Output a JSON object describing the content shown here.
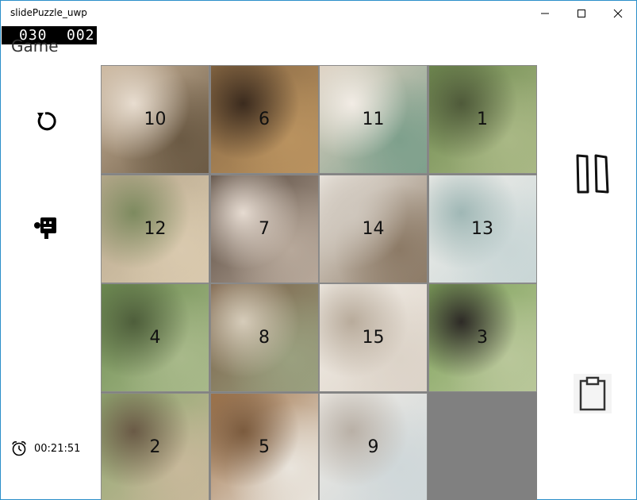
{
  "window": {
    "title": "slidePuzzle_uwp"
  },
  "counters": {
    "moves": "030",
    "steps": "002"
  },
  "page": {
    "title": "Game"
  },
  "timer": {
    "value": "00:21:51"
  },
  "board": {
    "rows": 4,
    "cols": 4,
    "tiles": [
      "10",
      "6",
      "11",
      "1",
      "12",
      "7",
      "14",
      "13",
      "4",
      "8",
      "15",
      "3",
      "2",
      "5",
      "9",
      ""
    ]
  },
  "icons": {
    "reset": "refresh-icon",
    "solver": "robot-icon",
    "pause": "pause-icon",
    "clipboard": "clipboard-icon",
    "alarm": "alarm-clock-icon"
  },
  "colors": {
    "window_border": "#2b8fc9",
    "empty_tile": "#808080",
    "counter_bg": "#000000",
    "counter_text": "#ffffff"
  }
}
